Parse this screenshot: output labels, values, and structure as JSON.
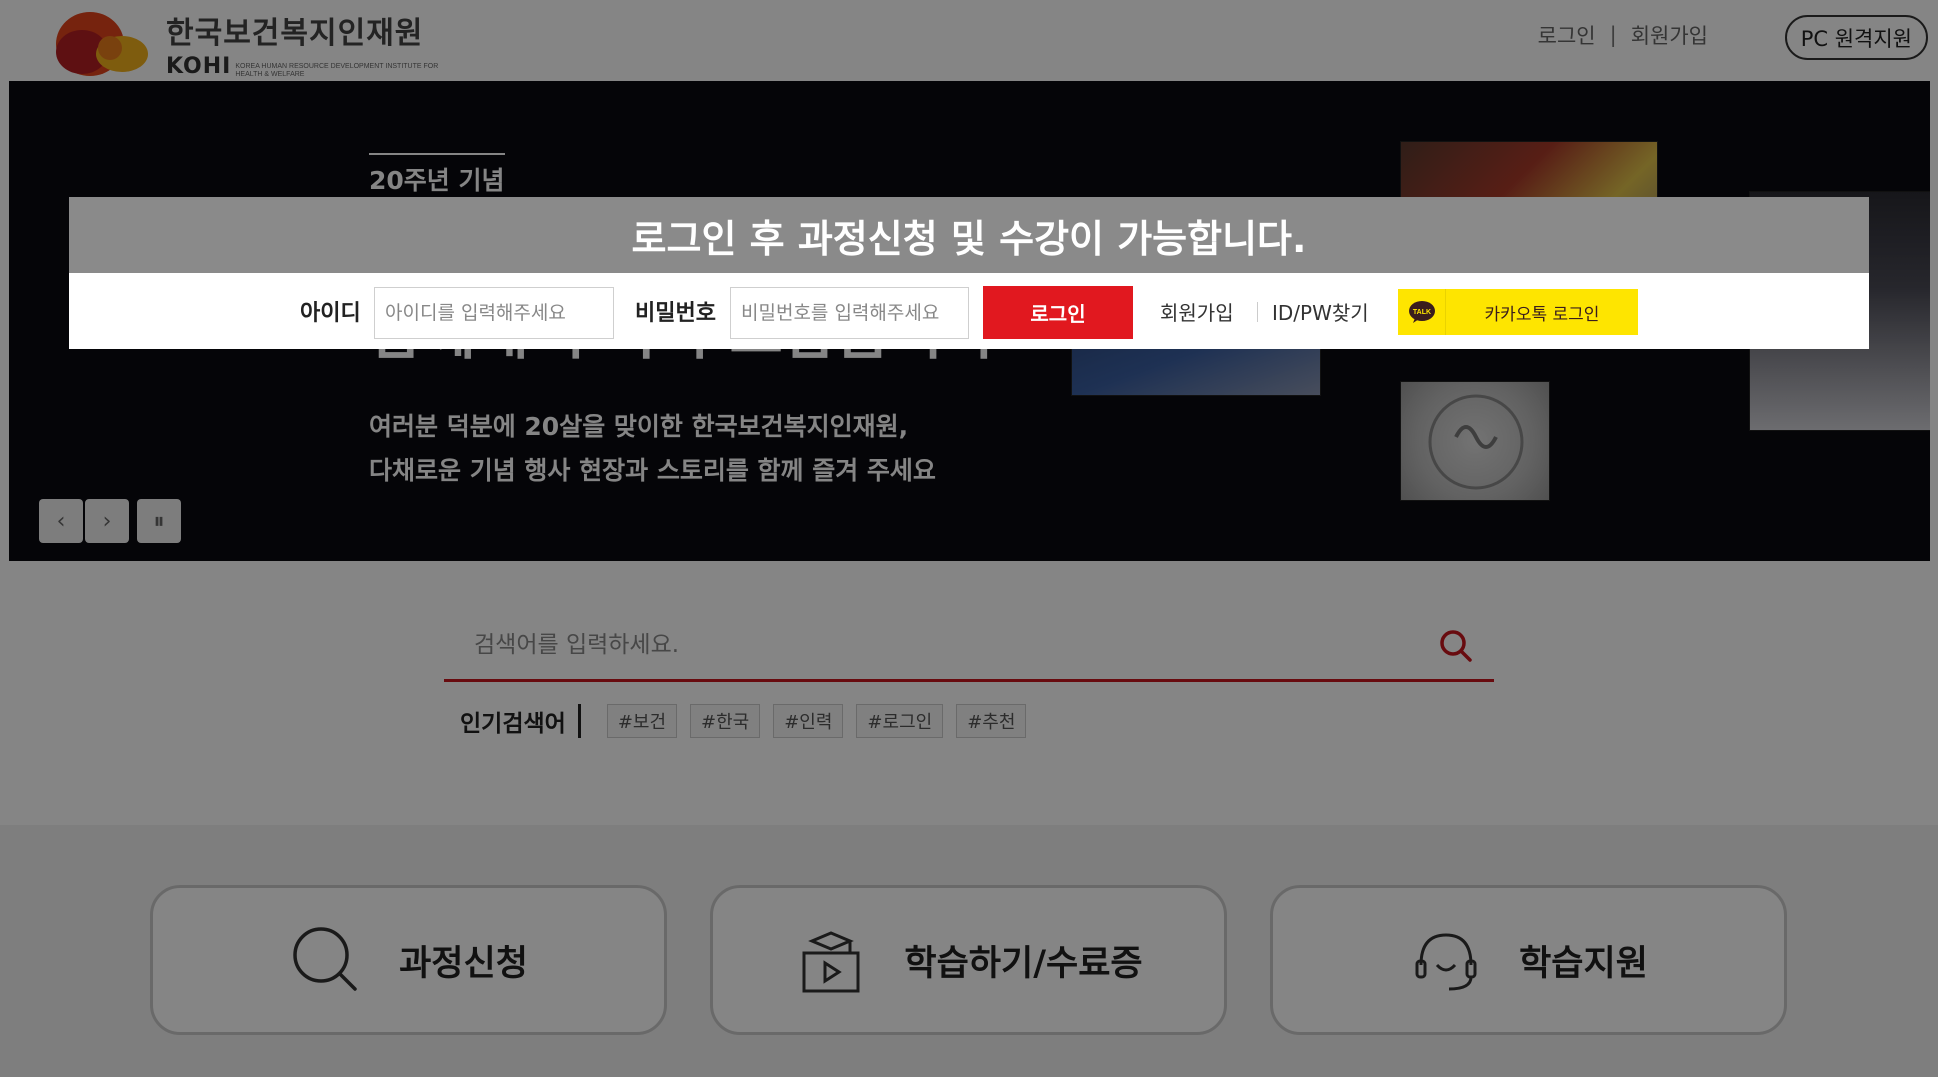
{
  "header": {
    "logo_kr": "한국보건복지인재원",
    "logo_en": "KOHI",
    "logo_sub": "KOREA HUMAN RESOURCE DEVELOPMENT INSTITUTE FOR HEALTH & WELFARE",
    "links": {
      "login": "로그인",
      "separator": "|",
      "signup": "회원가입"
    },
    "remote_support": "PC 원격지원"
  },
  "banner": {
    "badge": "20주년 기념",
    "headline": "함께해 주셔서 고맙습니다",
    "description_line1": "여러분 덕분에 20살을 맞이한 한국보건복지인재원,",
    "description_line2": "다채로운 기념 행사 현장과 스토리를 함께 즐겨 주세요",
    "controls": {
      "prev": "‹",
      "next": "›",
      "pause": "⏸"
    }
  },
  "search": {
    "placeholder": "검색어를 입력하세요.",
    "popular_label": "인기검색어",
    "tags": [
      "#보건",
      "#한국",
      "#인력",
      "#로그인",
      "#추천"
    ]
  },
  "quick_menu": [
    {
      "label": "과정신청",
      "icon": "search-icon"
    },
    {
      "label": "학습하기/수료증",
      "icon": "graduation-play-icon"
    },
    {
      "label": "학습지원",
      "icon": "headset-icon"
    }
  ],
  "login_modal": {
    "title": "로그인 후 과정신청 및 수강이 가능합니다.",
    "id_label": "아이디",
    "id_placeholder": "아이디를 입력해주세요",
    "pw_label": "비밀번호",
    "pw_placeholder": "비밀번호를 입력해주세요",
    "login_button": "로그인",
    "signup_link": "회원가입",
    "find_link": "ID/PW찾기",
    "kakao_icon_text": "TALK",
    "kakao_login": "카카오톡 로그인"
  },
  "colors": {
    "accent_red": "#e1181f",
    "kakao_yellow": "#fee500",
    "overlay": "rgba(0,0,0,0.48)"
  }
}
